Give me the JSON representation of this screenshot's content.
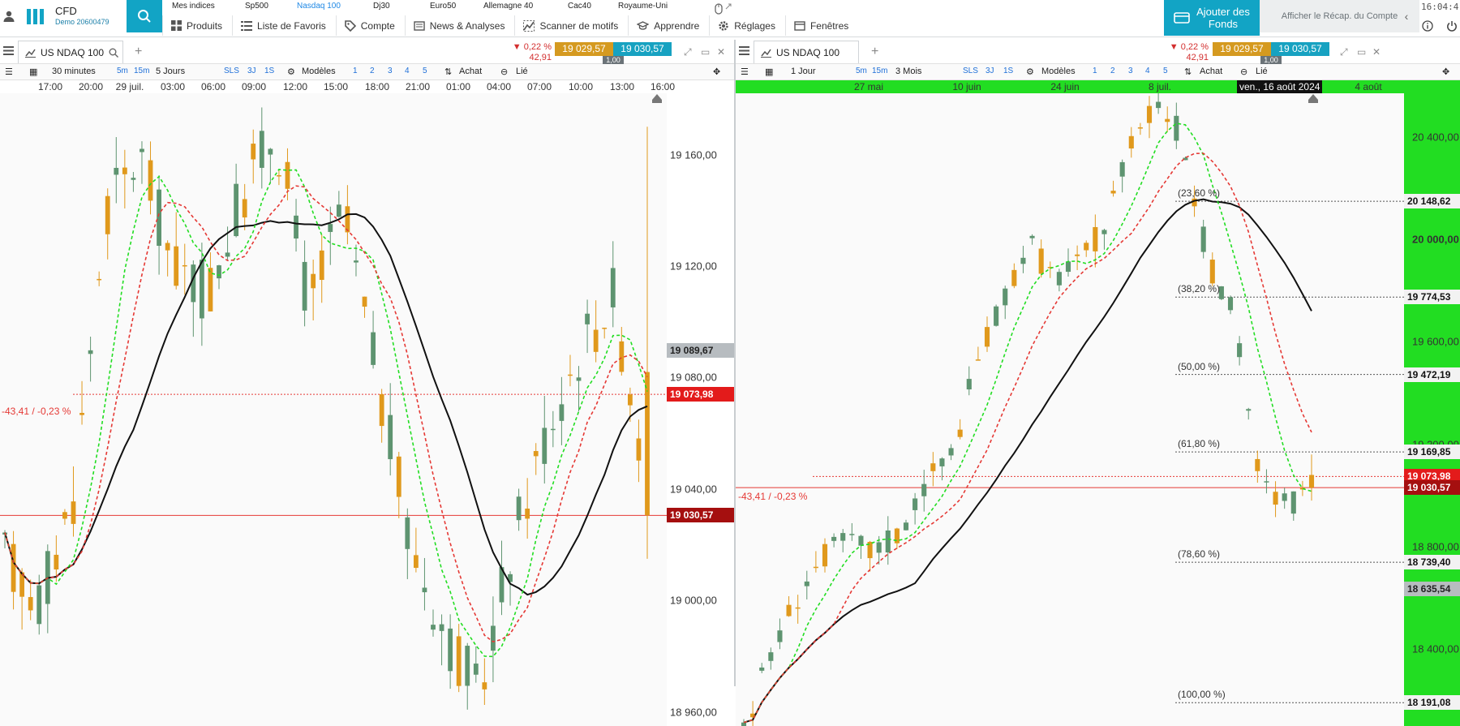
{
  "header": {
    "brand": "CFD",
    "account": "Demo 20600479",
    "instruments": [
      {
        "label": "Mes indices",
        "active": false
      },
      {
        "label": "Sp500",
        "active": false
      },
      {
        "label": "Nasdaq 100",
        "active": true
      },
      {
        "label": "Dj30",
        "active": false
      },
      {
        "label": "Euro50",
        "active": false
      },
      {
        "label": "Allemagne 40",
        "active": false
      },
      {
        "label": "Cac40",
        "active": false
      },
      {
        "label": "Royaume-Uni",
        "active": false
      }
    ],
    "menu": [
      "Produits",
      "Liste de Favoris",
      "Compte",
      "News & Analyses",
      "Scanner de motifs",
      "Apprendre",
      "Réglages",
      "Fenêtres"
    ],
    "add_funds": "Ajouter des Fonds",
    "account_summary": "Afficher le Récap. du Compte",
    "clock": "16:04:4"
  },
  "left": {
    "tab": "US NDAQ 100",
    "change_pct": "▼ 0,22 %",
    "change_pts": "42,91",
    "bid": "19 029,57",
    "ask": "19 030,57",
    "size": "1,00",
    "interval": "30 minutes",
    "period": "5 Jours",
    "quick_intervals": [
      "5m",
      "15m"
    ],
    "quick_periods": [
      "SLS",
      "3J",
      "1S"
    ],
    "models": "Modèles",
    "layout_numbers": [
      "1",
      "2",
      "3",
      "4",
      "5"
    ],
    "buy": "Achat",
    "linked": "Lié",
    "time_labels": [
      "17:00",
      "20:00",
      "29 juil.",
      "03:00",
      "06:00",
      "09:00",
      "12:00",
      "15:00",
      "18:00",
      "21:00",
      "01:00",
      "04:00",
      "07:00",
      "10:00",
      "13:00",
      "16:00"
    ],
    "price_labels": [
      "19 160,00",
      "19 120,00",
      "19 080,00",
      "19 040,00",
      "19 000,00",
      "18 960,00"
    ],
    "tag_gray": "19 089,67",
    "tag_red": "19 073,98",
    "tag_dark": "19 030,57",
    "pct_line_label": "-43,41 / -0,23 %"
  },
  "right": {
    "tab": "US NDAQ 100",
    "change_pct": "▼ 0,22 %",
    "change_pts": "42,91",
    "bid": "19 029,57",
    "ask": "19 030,57",
    "size": "1,00",
    "interval": "1 Jour",
    "period": "3 Mois",
    "quick_intervals": [
      "5m",
      "15m"
    ],
    "quick_periods": [
      "SLS",
      "3J",
      "1S"
    ],
    "models": "Modèles",
    "layout_numbers": [
      "1",
      "2",
      "3",
      "4",
      "5"
    ],
    "buy": "Achat",
    "linked": "Lié",
    "time_labels": [
      "27 mai",
      "10 juin",
      "24 juin",
      "8 juil.",
      "4 août"
    ],
    "date_tag": "ven., 16 août 2024",
    "price_labels": [
      "20 400,00",
      "20 000,00",
      "19 600,00",
      "19 200,00",
      "18 800,00",
      "18 400,00"
    ],
    "fib_tags": [
      "20 148,62",
      "19 774,53",
      "19 472,19",
      "19 169,85",
      "18 739,40",
      "18 191,08"
    ],
    "fib_labels": [
      "(23,60 %)",
      "(38,20 %)",
      "(50,00 %)",
      "(61,80 %)",
      "(78,60 %)",
      "(100,00 %)"
    ],
    "tag_red": "19 073,98",
    "tag_dark": "19 030,57",
    "tag_gray": "18 635,54",
    "pct_line_label": "-43,41 / -0,23 %"
  },
  "colors": {
    "accent": "#12a4c5",
    "bull": "#5e9470",
    "bear": "#e0991c",
    "ma_black": "#111111",
    "ma_green": "#22dd22",
    "ma_red": "#e53935",
    "axis_green": "#22dd22"
  },
  "chart_data": [
    {
      "type": "candlestick",
      "title": "US NDAQ 100",
      "interval": "30 minutes",
      "period": "5 Jours",
      "x_labels": [
        "17:00",
        "20:00",
        "29 juil.",
        "03:00",
        "06:00",
        "09:00",
        "12:00",
        "15:00",
        "18:00",
        "21:00",
        "01:00",
        "04:00",
        "07:00",
        "10:00",
        "13:00",
        "16:00"
      ],
      "y_labels": [
        "19 160,00",
        "19 120,00",
        "19 080,00",
        "19 040,00",
        "19 000,00",
        "18 960,00"
      ],
      "ylim": [
        18955,
        19182
      ],
      "last_price": 19030.57,
      "reference_price": 19073.98,
      "overlays": [
        "moving average (black, solid)",
        "moving average (green, dashed)",
        "moving average (red, dashed)"
      ]
    },
    {
      "type": "candlestick",
      "title": "US NDAQ 100",
      "interval": "1 Jour",
      "period": "3 Mois",
      "x_labels": [
        "27 mai",
        "10 juin",
        "24 juin",
        "8 juil.",
        "4 août"
      ],
      "y_labels": [
        "20 400,00",
        "20 000,00",
        "19 600,00",
        "19 200,00",
        "18 800,00",
        "18 400,00"
      ],
      "ylim": [
        18100,
        20570
      ],
      "last_price": 19030.57,
      "fibonacci": [
        {
          "level": "23,60 %",
          "price": 20148.62
        },
        {
          "level": "38,20 %",
          "price": 19774.53
        },
        {
          "level": "50,00 %",
          "price": 19472.19
        },
        {
          "level": "61,80 %",
          "price": 19169.85
        },
        {
          "level": "78,60 %",
          "price": 18739.4
        },
        {
          "level": "100,00 %",
          "price": 18191.08
        }
      ],
      "overlays": [
        "moving average (black, solid)",
        "moving average (green, dashed)",
        "moving average (red, dashed)"
      ]
    }
  ]
}
